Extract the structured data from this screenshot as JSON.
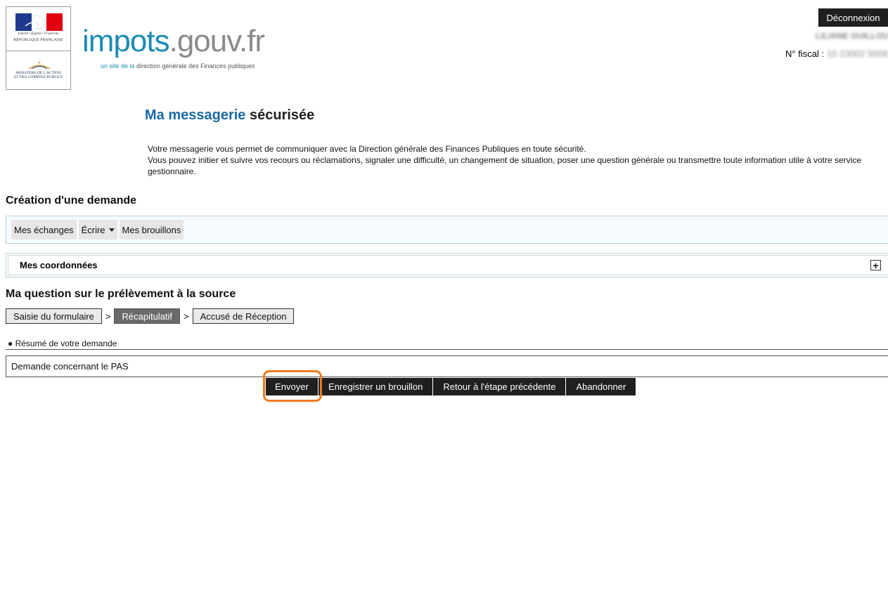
{
  "header": {
    "logo": {
      "motto": "Liberté • Égalité • Fraternité",
      "republique": "RÉPUBLIQUE FRANÇAISE",
      "ministere_line1": "MINISTÈRE DE L'ACTION",
      "ministere_line2": "ET DES COMPTES PUBLICS",
      "flag_colors": [
        "#1f3a8e",
        "#ffffff",
        "#e1000f"
      ]
    },
    "brand": {
      "part1": "impots",
      "part2": ".gouv.fr",
      "tagline_a": "un site de la",
      "tagline_b": " direction générale des Finances publiques"
    },
    "logout_label": "Déconnexion",
    "user_name": "LILIANE GUILLOU",
    "fiscal_label": "N° fiscal :",
    "fiscal_value": "10 23002 5008"
  },
  "page": {
    "title_part1": "Ma messagerie",
    "title_part2": " sécurisée",
    "intro_line1": "Votre messagerie vous permet de communiquer avec la Direction générale des Finances Publiques en toute sécurité.",
    "intro_line2": "Vous pouvez initier et suivre vos recours ou réclamations, signaler une difficulté, un changement de situation, poser une question générale ou transmettre toute information utile à votre service gestionnaire."
  },
  "creation": {
    "heading": "Création d'une demande",
    "nav": {
      "exchanges": "Mes échanges",
      "write": "Écrire",
      "drafts": "Mes brouillons"
    },
    "coordinates_label": "Mes coordonnées",
    "expand_symbol": "+"
  },
  "question": {
    "heading": "Ma question sur le prélèvement à la source",
    "steps": [
      {
        "label": "Saisie du formulaire",
        "active": false
      },
      {
        "label": "Récapitulatif",
        "active": true
      },
      {
        "label": "Accusé de Réception",
        "active": false
      }
    ],
    "step_separator": ">",
    "summary_bullet": "●",
    "summary_label": " Résumé de votre demande",
    "summary_value": "Demande concernant le PAS"
  },
  "actions": {
    "send": "Envoyer",
    "save_draft": "Enregistrer un brouillon",
    "back": "Retour à l'étape précédente",
    "abandon": "Abandonner",
    "highlight_color": "#f07a22"
  },
  "colors": {
    "brand_blue": "#1b8bb4",
    "title_blue": "#1a6aa5",
    "button_dark": "#1f1f1f",
    "active_step": "#6a6a6a"
  }
}
